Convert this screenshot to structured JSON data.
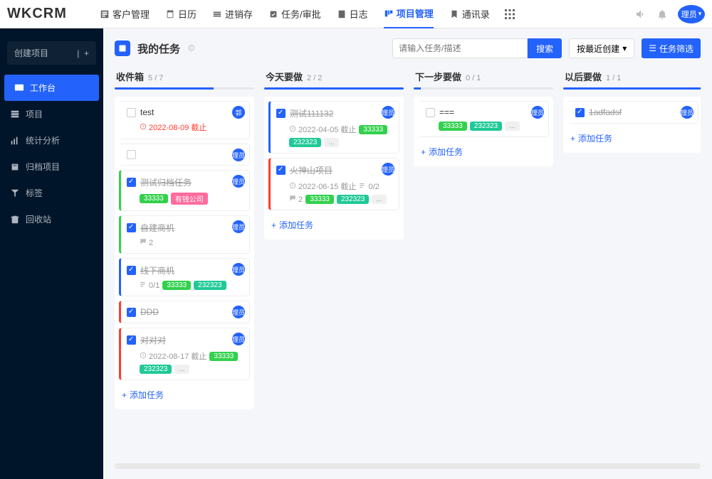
{
  "logo": "WKCRM",
  "nav": [
    {
      "label": "客户管理"
    },
    {
      "label": "日历"
    },
    {
      "label": "进销存"
    },
    {
      "label": "任务/审批"
    },
    {
      "label": "日志"
    },
    {
      "label": "项目管理",
      "active": true
    },
    {
      "label": "通讯录"
    }
  ],
  "user_short": "理员",
  "sidebar": {
    "create": "创建项目",
    "items": [
      {
        "label": "工作台",
        "active": true
      },
      {
        "label": "项目"
      },
      {
        "label": "统计分析"
      },
      {
        "label": "归档项目"
      },
      {
        "label": "标签"
      },
      {
        "label": "回收站"
      }
    ]
  },
  "page_title": "我的任务",
  "search_placeholder": "请输入任务/描述",
  "search_btn": "搜索",
  "sort_btn": "按最近创建",
  "filter_btn": "任务筛选",
  "add_task_label": "添加任务",
  "columns": [
    {
      "title": "收件箱",
      "count": "5 / 7",
      "progress": 71,
      "cards": [
        {
          "title": "test",
          "done": false,
          "avatar": "郭",
          "date": "2022-08-09 截止",
          "date_red": true,
          "priority": ""
        },
        {
          "title": "",
          "done": false,
          "avatar": "理员",
          "priority": ""
        },
        {
          "title": "测试归档任务",
          "done": true,
          "avatar": "理员",
          "priority": "green",
          "tags": [
            {
              "text": "33333",
              "cls": "green"
            },
            {
              "text": "有钱公司",
              "cls": "pink"
            }
          ]
        },
        {
          "title": "自建商机",
          "done": true,
          "avatar": "理员",
          "priority": "green",
          "sub": "2"
        },
        {
          "title": "线下商机",
          "done": true,
          "avatar": "理员",
          "priority": "blue",
          "subcount": "0/1",
          "tags": [
            {
              "text": "33333",
              "cls": "green"
            },
            {
              "text": "232323",
              "cls": "teal"
            }
          ]
        },
        {
          "title": "DDD",
          "done": true,
          "avatar": "理员",
          "priority": "red"
        },
        {
          "title": "对对对",
          "done": true,
          "avatar": "理员",
          "priority": "red",
          "date": "2022-08-17 截止",
          "tags": [
            {
              "text": "33333",
              "cls": "green"
            },
            {
              "text": "232323",
              "cls": "teal"
            },
            {
              "text": "...",
              "cls": "gray"
            }
          ]
        }
      ]
    },
    {
      "title": "今天要做",
      "count": "2 / 2",
      "progress": 100,
      "cards": [
        {
          "title": "测试111132",
          "done": true,
          "avatar": "理员",
          "priority": "blue",
          "date": "2022-04-05 截止",
          "tags": [
            {
              "text": "33333",
              "cls": "green"
            },
            {
              "text": "232323",
              "cls": "teal"
            },
            {
              "text": "...",
              "cls": "gray"
            }
          ]
        },
        {
          "title": "火神山项目",
          "done": true,
          "avatar": "理员",
          "priority": "red",
          "date": "2022-06-15 截止",
          "subcount": "0/2",
          "sub": "2",
          "tags": [
            {
              "text": "33333",
              "cls": "green"
            },
            {
              "text": "232323",
              "cls": "teal"
            },
            {
              "text": "...",
              "cls": "gray"
            }
          ]
        }
      ]
    },
    {
      "title": "下一步要做",
      "count": "0 / 1",
      "progress": 5,
      "cards": [
        {
          "title": "===",
          "done": false,
          "avatar": "理员",
          "priority": "",
          "tags": [
            {
              "text": "33333",
              "cls": "green"
            },
            {
              "text": "232323",
              "cls": "teal"
            },
            {
              "text": "...",
              "cls": "gray"
            }
          ]
        }
      ]
    },
    {
      "title": "以后要做",
      "count": "1 / 1",
      "progress": 100,
      "cards": [
        {
          "title": "1adfadsf",
          "done": true,
          "avatar": "理员",
          "priority": ""
        }
      ]
    }
  ]
}
